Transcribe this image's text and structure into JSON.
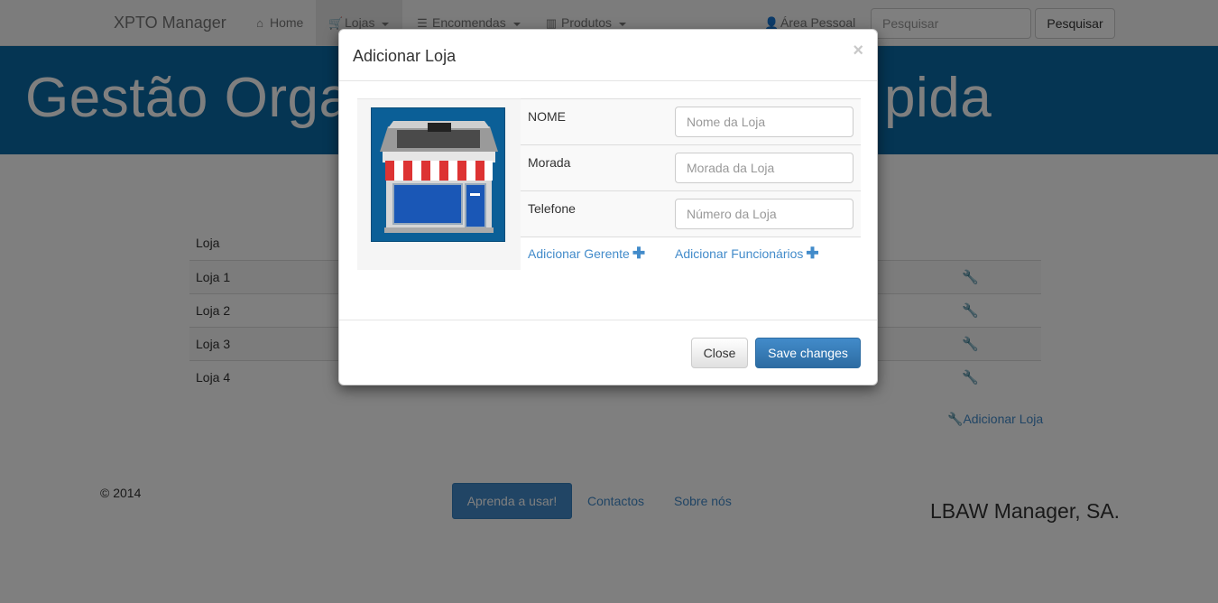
{
  "navbar": {
    "brand": "XPTO Manager",
    "items": [
      {
        "label": "Home",
        "icon": "home-icon"
      },
      {
        "label": "Lojas",
        "icon": "cart-icon",
        "active": true
      },
      {
        "label": "Encomendas",
        "icon": "list-icon"
      },
      {
        "label": "Produtos",
        "icon": "barcode-icon"
      }
    ],
    "user_area": "Área Pessoal",
    "search": {
      "placeholder": "Pesquisar",
      "button": "Pesquisar"
    }
  },
  "banner": {
    "title_left": "Gestão Orga",
    "title_right": "pida"
  },
  "table": {
    "header": "Loja",
    "rows": [
      "Loja 1",
      "Loja 2",
      "Loja 3",
      "Loja 4"
    ],
    "add_label": "Adicionar Loja"
  },
  "footer": {
    "copyright": "© 2014",
    "learn_button": "Aprenda a usar!",
    "links": [
      "Contactos",
      "Sobre nós"
    ],
    "company": "LBAW Manager, SA."
  },
  "modal": {
    "title": "Adicionar Loja",
    "close_symbol": "×",
    "fields": [
      {
        "label": "NOME",
        "placeholder": "Nome da Loja"
      },
      {
        "label": "Morada",
        "placeholder": "Morada da Loja"
      },
      {
        "label": "Telefone",
        "placeholder": "Número da Loja"
      }
    ],
    "add_manager": "Adicionar Gerente",
    "add_employees": "Adicionar Funcionários",
    "close_button": "Close",
    "save_button": "Save changes"
  },
  "colors": {
    "primary": "#428bca",
    "banner": "#0a6aa6"
  }
}
